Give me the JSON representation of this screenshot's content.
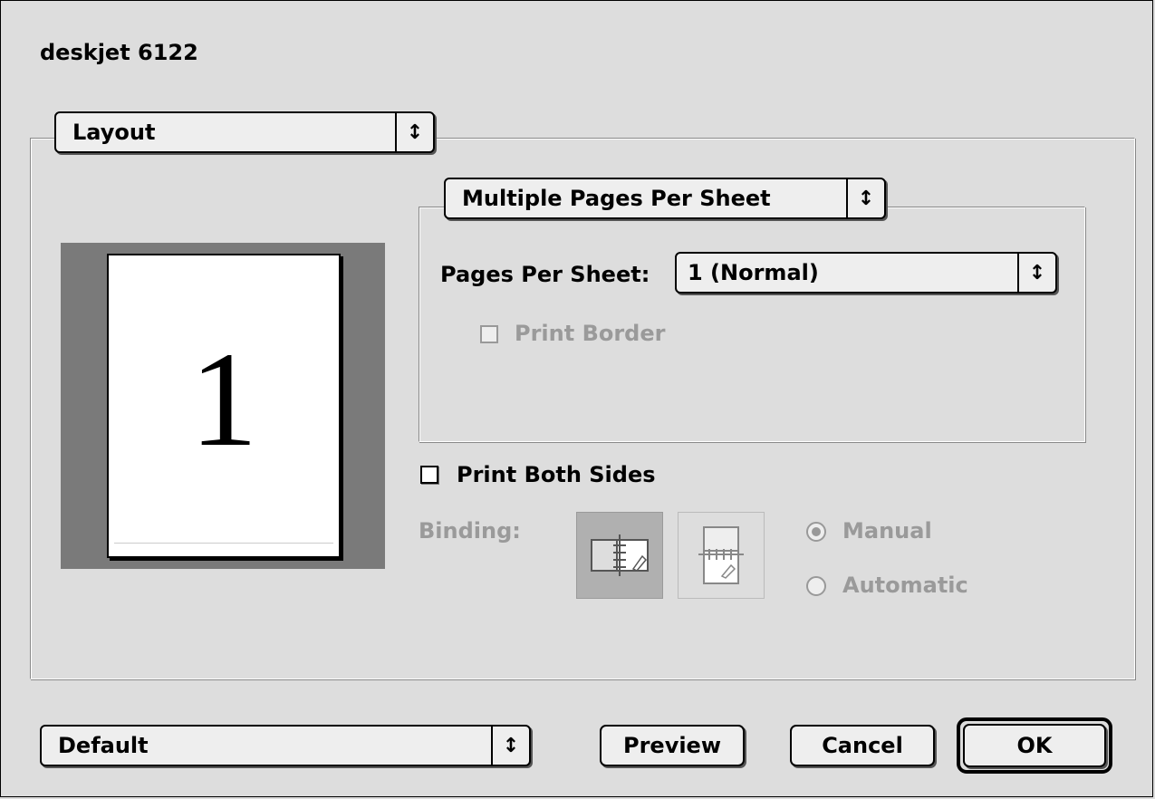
{
  "window": {
    "title": "deskjet 6122"
  },
  "panel_menu": {
    "selected": "Layout",
    "arrows_icon": "popup-arrows-icon"
  },
  "layout_mode_menu": {
    "selected": "Multiple Pages Per Sheet"
  },
  "pages_per_sheet": {
    "label": "Pages Per Sheet:",
    "selected": "1 (Normal)"
  },
  "print_border": {
    "label": "Print Border",
    "checked": false,
    "enabled": false
  },
  "preview": {
    "page_number": "1"
  },
  "print_both_sides": {
    "label": "Print Both Sides",
    "checked": false,
    "enabled": true
  },
  "binding": {
    "label": "Binding:",
    "options": [
      "book-binding-icon",
      "tablet-binding-icon"
    ],
    "selected_index": 0
  },
  "duplex_mode": {
    "options": [
      {
        "label": "Manual",
        "selected": true
      },
      {
        "label": "Automatic",
        "selected": false
      }
    ],
    "enabled": false
  },
  "presets_menu": {
    "selected": "Default"
  },
  "buttons": {
    "preview": "Preview",
    "cancel": "Cancel",
    "ok": "OK"
  },
  "colors": {
    "background": "#dddddd",
    "disabled_text": "#9a9a9a",
    "preview_bg": "#7a7a7a"
  }
}
